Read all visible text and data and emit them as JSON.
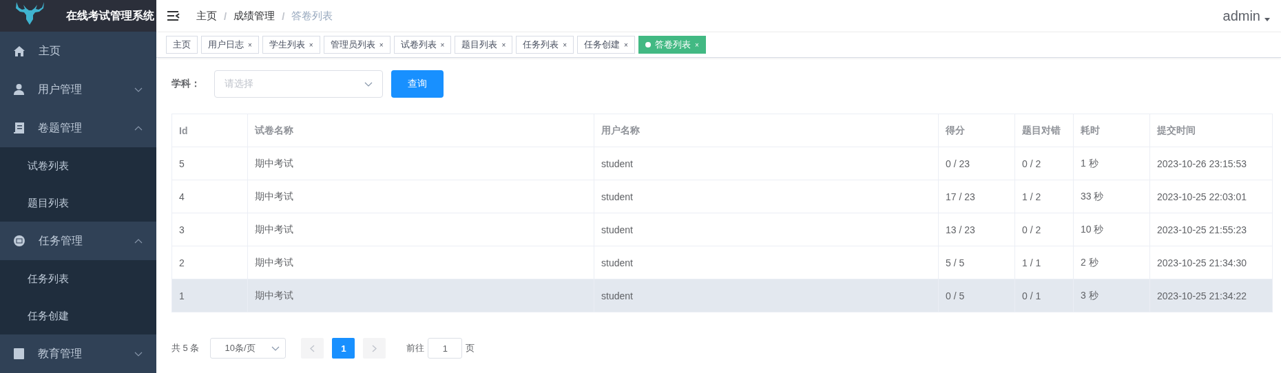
{
  "sidebar": {
    "title": "在线考试管理系统",
    "menu": [
      {
        "label": "主页"
      },
      {
        "label": "用户管理",
        "expanded": false
      },
      {
        "label": "卷题管理",
        "expanded": true,
        "children": [
          {
            "label": "试卷列表"
          },
          {
            "label": "题目列表"
          }
        ]
      },
      {
        "label": "任务管理",
        "expanded": true,
        "children": [
          {
            "label": "任务列表"
          },
          {
            "label": "任务创建"
          }
        ]
      },
      {
        "label": "教育管理",
        "expanded": false
      }
    ]
  },
  "breadcrumb": [
    {
      "label": "主页",
      "current": false
    },
    {
      "label": "成绩管理",
      "current": false
    },
    {
      "label": "答卷列表",
      "current": true
    }
  ],
  "breadcrumb_separator": "/",
  "user": "admin",
  "tabs": [
    {
      "label": "主页",
      "closable": false,
      "selected": false
    },
    {
      "label": "用户日志",
      "closable": true,
      "selected": false
    },
    {
      "label": "学生列表",
      "closable": true,
      "selected": false
    },
    {
      "label": "管理员列表",
      "closable": true,
      "selected": false
    },
    {
      "label": "试卷列表",
      "closable": true,
      "selected": false
    },
    {
      "label": "题目列表",
      "closable": true,
      "selected": false
    },
    {
      "label": "任务列表",
      "closable": true,
      "selected": false
    },
    {
      "label": "任务创建",
      "closable": true,
      "selected": false
    },
    {
      "label": "答卷列表",
      "closable": true,
      "selected": true
    }
  ],
  "close_glyph": "×",
  "filter": {
    "label": "学科：",
    "placeholder": "请选择",
    "button": "查询"
  },
  "table": {
    "columns": [
      "Id",
      "试卷名称",
      "用户名称",
      "得分",
      "题目对错",
      "耗时",
      "提交时间"
    ],
    "rows": [
      {
        "cells": [
          "5",
          "期中考试",
          "student",
          "0 / 23",
          "0 / 2",
          "1 秒",
          "2023-10-26 23:15:53"
        ],
        "hovered": false
      },
      {
        "cells": [
          "4",
          "期中考试",
          "student",
          "17 / 23",
          "1 / 2",
          "33 秒",
          "2023-10-25 22:03:01"
        ],
        "hovered": false
      },
      {
        "cells": [
          "3",
          "期中考试",
          "student",
          "13 / 23",
          "0 / 2",
          "10 秒",
          "2023-10-25 21:55:23"
        ],
        "hovered": false
      },
      {
        "cells": [
          "2",
          "期中考试",
          "student",
          "5 / 5",
          "1 / 1",
          "2 秒",
          "2023-10-25 21:34:30"
        ],
        "hovered": false
      },
      {
        "cells": [
          "1",
          "期中考试",
          "student",
          "0 / 5",
          "0 / 1",
          "3 秒",
          "2023-10-25 21:34:22"
        ],
        "hovered": true
      }
    ]
  },
  "pagination": {
    "total": "共 5 条",
    "page_size": "10条/页",
    "pages": [
      {
        "label": "1",
        "selected": true
      }
    ],
    "goto_label": "前往",
    "goto_value": "1",
    "goto_suffix": "页"
  }
}
